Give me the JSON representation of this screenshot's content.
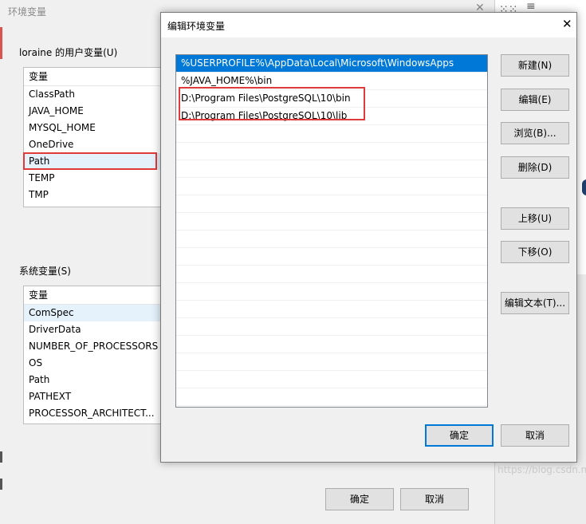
{
  "background": {
    "watermark": "https://blog.csdn.net/w",
    "icons": [
      "grid-icon",
      "menu-icon",
      "avatar-icon"
    ]
  },
  "env_window": {
    "title": "环境变量",
    "user_group_label": "loraine 的用户变量(U)",
    "user_list": {
      "header": "变量",
      "rows": [
        "ClassPath",
        "JAVA_HOME",
        "MYSQL_HOME",
        "OneDrive",
        "Path",
        "TEMP",
        "TMP"
      ]
    },
    "system_group_label": "系统变量(S)",
    "system_list": {
      "header": "变量",
      "rows": [
        "ComSpec",
        "DriverData",
        "NUMBER_OF_PROCESSORS",
        "OS",
        "Path",
        "PATHEXT",
        "PROCESSOR_ARCHITECT..."
      ]
    },
    "ok_label": "确定",
    "cancel_label": "取消"
  },
  "edit_dialog": {
    "title": "编辑环境变量",
    "paths": [
      "%USERPROFILE%\\AppData\\Local\\Microsoft\\WindowsApps",
      "%JAVA_HOME%\\bin",
      "D:\\Program Files\\PostgreSQL\\10\\bin",
      "D:\\Program Files\\PostgreSQL\\10\\lib"
    ],
    "selected_index": 0,
    "buttons": {
      "new": "新建(N)",
      "edit": "编辑(E)",
      "browse": "浏览(B)...",
      "delete": "删除(D)",
      "move_up": "上移(U)",
      "move_down": "下移(O)",
      "edit_text": "编辑文本(T)..."
    },
    "ok_label": "确定",
    "cancel_label": "取消"
  },
  "colors": {
    "accent": "#0078d7",
    "highlight_border": "#e03a3a"
  }
}
